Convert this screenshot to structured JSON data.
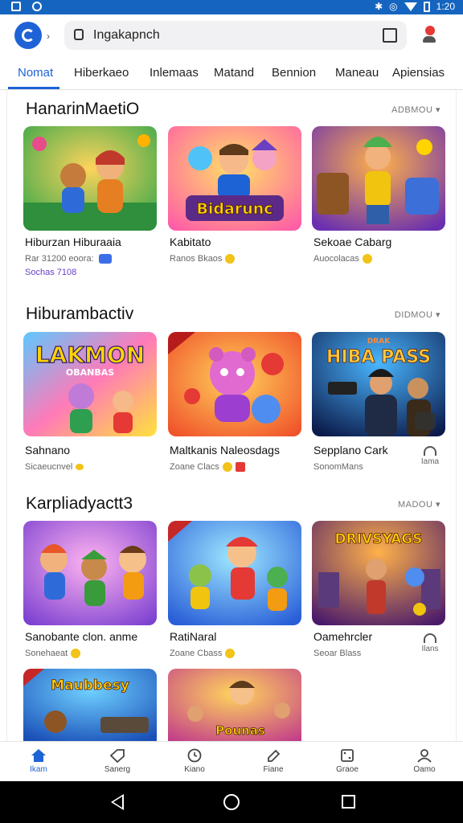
{
  "status_bar": {
    "time": "1:20"
  },
  "browser": {
    "url": "Ingakapnch"
  },
  "tabs": [
    "Nomat",
    "Hiberkaeo",
    "Inlemaas",
    "Matand",
    "Bennion",
    "Maneau",
    "Apiensias"
  ],
  "sections": [
    {
      "title": "HanarinMaetiO",
      "more": "ADBMOU",
      "cards": [
        {
          "title": "Hiburzan Hiburaaia",
          "sub": "Rar 31200 eoora:",
          "sub2": "Sochas 7108"
        },
        {
          "title": "Kabitato",
          "sub": "Ranos Bkaos"
        },
        {
          "title": "Sekoae Cabarg",
          "sub": "Auocolacas"
        }
      ]
    },
    {
      "title": "Hiburambactiv",
      "more": "DIDMOU",
      "cards": [
        {
          "title": "Sahnano",
          "sub": "Sicaeucnvel"
        },
        {
          "title": "Maltkanis Naleosdags",
          "sub": "Zoane Clacs"
        },
        {
          "title": "Sepplano Cark",
          "sub": "SonomMans",
          "side": "Iama"
        }
      ]
    },
    {
      "title": "Karpliadyactt3",
      "more": "MADOU",
      "cards": [
        {
          "title": "Sanobante clon. anme",
          "sub": "Sonehaeat"
        },
        {
          "title": "RatiNaral",
          "sub": "Zoane Cbass"
        },
        {
          "title": "Oamehrcler",
          "sub": "Seoar Blass",
          "side": "Ilans"
        }
      ]
    }
  ],
  "thumb_text": {
    "r1c2": "Bidarunc",
    "r2c1": "LAKMON",
    "r2c1_sub": "OBANBAS",
    "r2c3": "HIBA PASS",
    "r2c3_top": "DRAK",
    "r3c3": "DRIVSYAGS",
    "r4c1": "Maubbesy",
    "r4c2": "Pounas"
  },
  "bottom_nav": [
    "Ikam",
    "Sanerg",
    "Kiano",
    "Fiane",
    "Graoe",
    "Oamo"
  ],
  "colors": {
    "accent": "#1e63d6",
    "status_bar": "#1565c0"
  }
}
